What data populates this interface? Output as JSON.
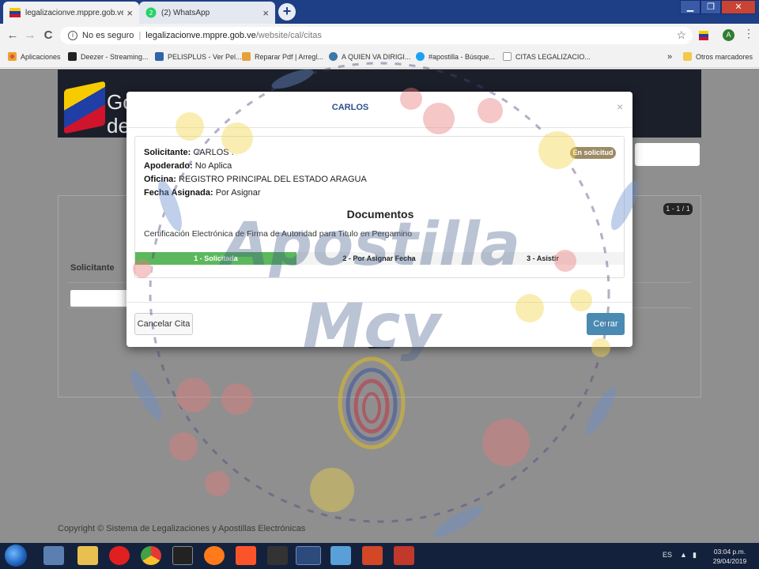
{
  "browser": {
    "tabs": [
      {
        "title": "legalizacionve.mppre.gob.ve/web",
        "close": "×",
        "active": true
      },
      {
        "title": "(2) WhatsApp",
        "close": "×",
        "active": false
      }
    ],
    "new_tab": "+",
    "window_controls": {
      "minimize": "▁",
      "restore": "❐",
      "close": "✕"
    },
    "nav": {
      "back": "←",
      "forward": "→",
      "reload": "C"
    },
    "address": {
      "security": "No es seguro",
      "separator": "|",
      "host": "legalizacionve.mppre.gob.ve",
      "path": "/website/cal/citas"
    },
    "star": "☆",
    "menu": "⋮",
    "profile_initial": "A"
  },
  "bookmarks": [
    {
      "label": "Aplicaciones",
      "color": "#d35b3a"
    },
    {
      "label": "Deezer - Streaming...",
      "color": "#222222"
    },
    {
      "label": "PELISPLUS - Ver Pel...",
      "color": "#2f65a8"
    },
    {
      "label": "Reparar Pdf | Arregl...",
      "color": "#e4a23a"
    },
    {
      "label": "A QUIEN VA DIRIGI...",
      "color": "#3b77a8"
    },
    {
      "label": "#apostilla - Búsque...",
      "color": "#1da1f2"
    },
    {
      "label": "CITAS LEGALIZACIO...",
      "color": "#9a9a9a"
    }
  ],
  "bookmarks_more": "»",
  "bookmarks_other": "Otros marcadores",
  "page": {
    "header_text_line1": "Go",
    "header_text_line2": "de",
    "counter": "1 - 1 / 1",
    "table_col": "Solicitante",
    "copyright": "Copyright © Sistema de Legalizaciones y Apostillas Electrónicas"
  },
  "modal": {
    "title": "CARLOS",
    "close": "×",
    "status_badge": "En solicitud",
    "fields": [
      {
        "label": "Solicitante:",
        "value": "CARLOS ."
      },
      {
        "label": "Apoderado:",
        "value": "No Aplica"
      },
      {
        "label": "Oficina:",
        "value": "REGISTRO PRINCIPAL DEL ESTADO ARAGUA"
      },
      {
        "label": "Fecha Asignada:",
        "value": "Por Asignar"
      }
    ],
    "documents_title": "Documentos",
    "documents": [
      "Certificación Electrónica de Firma de Autoridad para Titulo en Pergamino"
    ],
    "steps": [
      {
        "label": "1 - Solicitada",
        "done": true
      },
      {
        "label": "2 - Por Asignar Fecha",
        "done": false
      },
      {
        "label": "3 - Asistir",
        "done": false
      }
    ],
    "cancel_button": "Cancelar Cita",
    "close_button": "Cerrar"
  },
  "watermark": {
    "line1": "Apostilla",
    "line2": "Mcy"
  },
  "taskbar": {
    "language": "ES",
    "time": "03:04 p.m.",
    "date": "29/04/2019",
    "apps": [
      "explorer-icon",
      "file-manager-icon",
      "opera-icon",
      "chrome-icon",
      "epic-games-icon",
      "firefox-icon",
      "brave-icon",
      "rl-icon",
      "chrome-active-icon",
      "notepad-icon",
      "powerpoint-icon",
      "pdf-icon"
    ]
  },
  "colors": {
    "accent_blue": "#4a8ab3",
    "success_green": "#5cb85c",
    "badge": "#9c8b66",
    "tab_strip": "#1e3f86"
  }
}
